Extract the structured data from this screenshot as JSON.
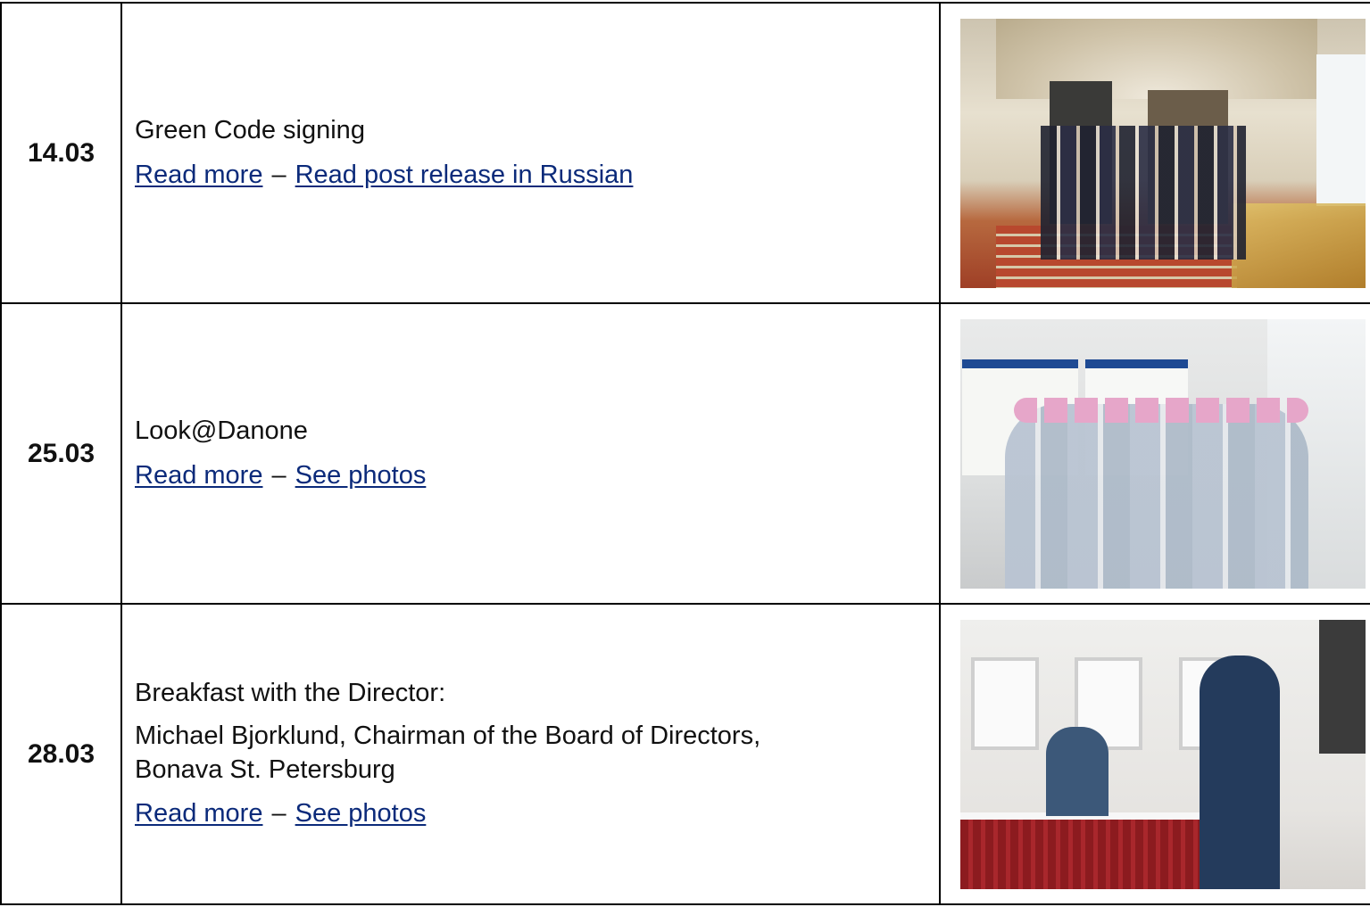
{
  "events": [
    {
      "date": "14.03",
      "titles": [
        "Green Code signing"
      ],
      "links": [
        {
          "label": "Read more"
        },
        {
          "label": "Read post release in Russian"
        }
      ],
      "separator": "–"
    },
    {
      "date": "25.03",
      "titles": [
        "Look@Danone"
      ],
      "links": [
        {
          "label": "Read more"
        },
        {
          "label": "See photos"
        }
      ],
      "separator": "–"
    },
    {
      "date": "28.03",
      "titles": [
        "Breakfast with the Director:",
        "Michael Bjorklund, Chairman of the Board of Directors, Bonava St. Petersburg"
      ],
      "links": [
        {
          "label": "Read more"
        },
        {
          "label": "See photos"
        }
      ],
      "separator": "–"
    }
  ],
  "colors": {
    "link": "#0b2a7a",
    "border": "#000000"
  }
}
